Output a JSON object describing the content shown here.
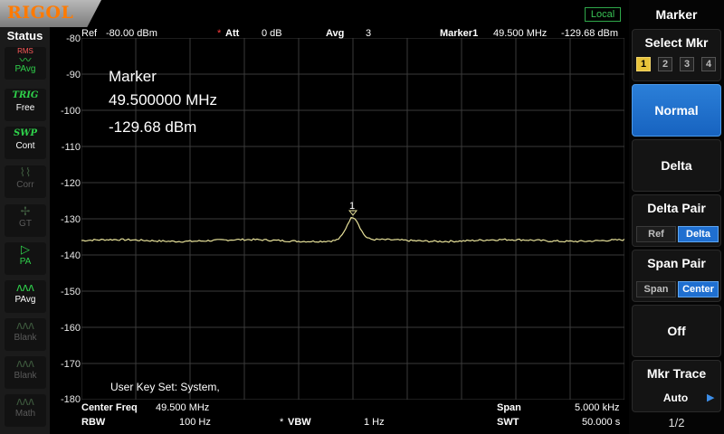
{
  "header": {
    "brand": "RIGOL",
    "remote_status": "Local",
    "ref_label": "Ref",
    "ref_value": "-80.00 dBm",
    "att_label": "Att",
    "att_value": "0 dB",
    "avg_label": "Avg",
    "avg_value": "3",
    "marker_label": "Marker1",
    "marker_freq": "49.500 MHz",
    "marker_amp": "-129.68 dBm"
  },
  "status_panel": {
    "title": "Status",
    "items": [
      {
        "icon_text": "RMS",
        "label": "PAvg",
        "active": true
      },
      {
        "icon_text": "TRIG",
        "label": "Free",
        "active": true
      },
      {
        "icon_text": "SWP",
        "label": "Cont",
        "active": true
      },
      {
        "icon_text": "Corr",
        "label": "Corr",
        "active": false
      },
      {
        "icon_text": "GT",
        "label": "GT",
        "active": false
      },
      {
        "icon_text": "PA",
        "label": "PA",
        "active": false
      },
      {
        "icon_text": "PAvg",
        "label": "PAvg",
        "active": true
      },
      {
        "icon_text": "Blank",
        "label": "Blank",
        "active": false
      },
      {
        "icon_text": "Blank",
        "label": "Blank",
        "active": false
      },
      {
        "icon_text": "Math",
        "label": "Math",
        "active": false
      }
    ]
  },
  "plot": {
    "y_axis_labels": [
      "-80",
      "-90",
      "-100",
      "-110",
      "-120",
      "-130",
      "-140",
      "-150",
      "-160",
      "-170",
      "-180"
    ],
    "marker_number": "1",
    "trace_color": "#e8e29a",
    "grid_color": "#3a3a3a",
    "noise_floor_dbm": -136,
    "peak_dbm": -129.68
  },
  "marker_readout": {
    "title": "Marker",
    "frequency": "49.500000 MHz",
    "amplitude": "-129.68 dBm"
  },
  "user_key_text": "User Key Set:  System,",
  "footer": {
    "center_freq_label": "Center Freq",
    "center_freq_value": "49.500 MHz",
    "span_label": "Span",
    "span_value": "5.000 kHz",
    "rbw_label": "RBW",
    "rbw_value": "100 Hz",
    "vbw_label": "VBW",
    "vbw_value": "1 Hz",
    "swt_label": "SWT",
    "swt_value": "50.000 s"
  },
  "menu": {
    "title": "Marker",
    "select_mkr": {
      "label": "Select Mkr",
      "options": [
        "1",
        "2",
        "3",
        "4"
      ],
      "selected": "1"
    },
    "normal": "Normal",
    "delta": "Delta",
    "delta_pair": {
      "label": "Delta Pair",
      "options": [
        "Ref",
        "Delta"
      ],
      "selected": "Delta"
    },
    "span_pair": {
      "label": "Span Pair",
      "options": [
        "Span",
        "Center"
      ],
      "selected": "Center"
    },
    "off": "Off",
    "mkr_trace": {
      "label": "Mkr Trace",
      "value": "Auto"
    },
    "page": "1/2"
  },
  "colors": {
    "accent_blue": "#1f6fd0",
    "logo_orange": "#ff7a00",
    "status_green": "#2fd14b",
    "marker_red": "#ff3b3b"
  }
}
